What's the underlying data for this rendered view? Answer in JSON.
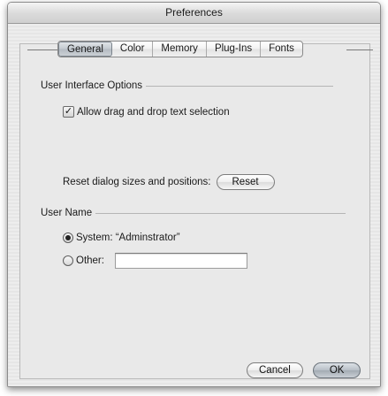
{
  "window": {
    "title": "Preferences"
  },
  "tabs": [
    {
      "label": "General",
      "active": true
    },
    {
      "label": "Color",
      "active": false
    },
    {
      "label": "Memory",
      "active": false
    },
    {
      "label": "Plug-Ins",
      "active": false
    },
    {
      "label": "Fonts",
      "active": false
    }
  ],
  "ui_options": {
    "title": "User Interface Options",
    "drag_drop_label": "Allow drag and drop text selection",
    "drag_drop_checked": true,
    "check_glyph": "✓"
  },
  "reset": {
    "label": "Reset dialog sizes and positions:",
    "button": "Reset"
  },
  "user_name": {
    "title": "User Name",
    "system_label": "System: “Adminstrator”",
    "system_selected": true,
    "other_label": "Other:",
    "other_value": "",
    "other_placeholder": ""
  },
  "buttons": {
    "cancel": "Cancel",
    "ok": "OK"
  }
}
